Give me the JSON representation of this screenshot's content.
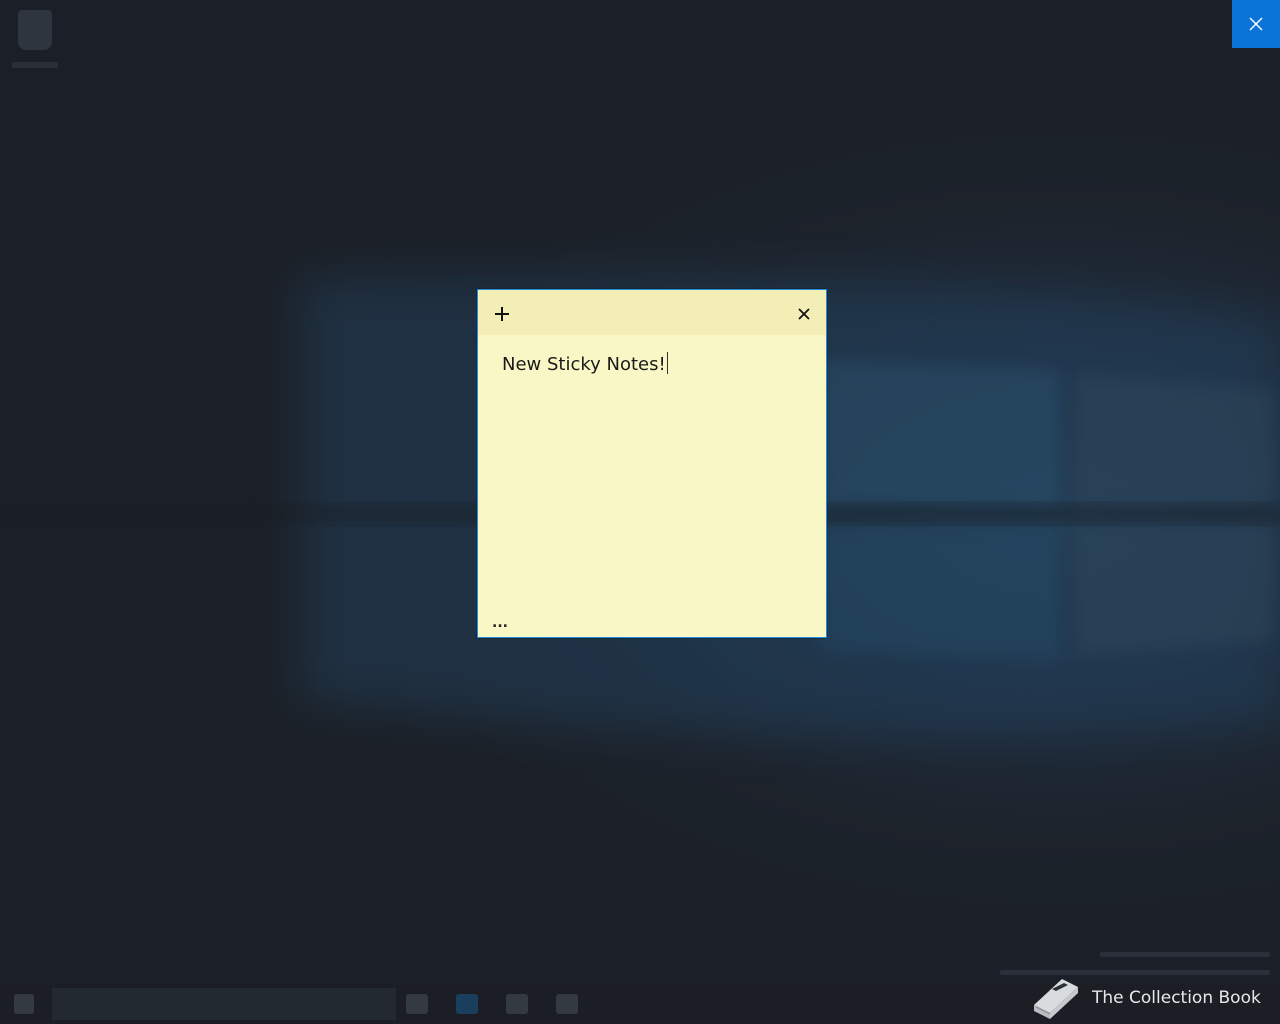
{
  "note": {
    "add_icon": "plus-icon",
    "close_icon": "close-icon",
    "text": "New Sticky Notes!",
    "menu_label": "...",
    "background_color": "#faf7c6",
    "header_color": "#f3eeb5",
    "border_color": "#1f8de0"
  },
  "overlay_close": {
    "icon": "close-icon",
    "background_color": "#0a74d8"
  },
  "watermark": {
    "text": "The Collection Book",
    "icon": "book-icon"
  }
}
